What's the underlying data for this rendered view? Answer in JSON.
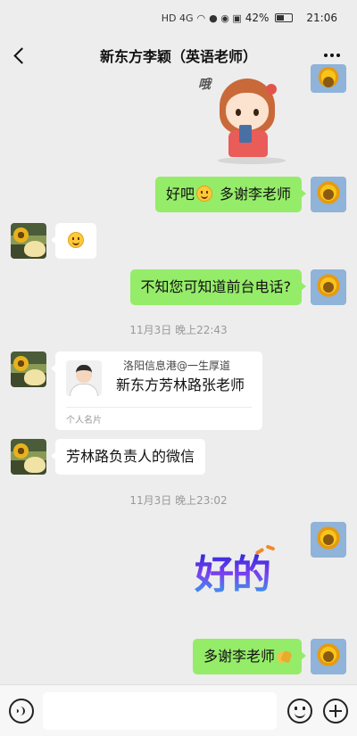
{
  "status_bar": {
    "network": "HD 4G",
    "battery": "42%",
    "time": "21:06"
  },
  "header": {
    "title": "新东方李颖（英语老师）"
  },
  "messages": [
    {
      "from": "me",
      "kind": "sticker",
      "sticker_text": "哦"
    },
    {
      "from": "me",
      "kind": "text",
      "text_before": "好吧",
      "emoji": "smile",
      "text_after": "多谢李老师"
    },
    {
      "from": "them",
      "kind": "emoji",
      "emoji": "smile"
    },
    {
      "from": "me",
      "kind": "text",
      "text": "不知您可知道前台电话?"
    },
    {
      "kind": "timestamp",
      "text": "11月3日 晚上22:43"
    },
    {
      "from": "them",
      "kind": "card",
      "watermark": "洛阳信息港@一生厚道",
      "name": "新东方芳林路张老师",
      "card_type": "个人名片"
    },
    {
      "from": "them",
      "kind": "text",
      "text": "芳林路负责人的微信"
    },
    {
      "kind": "timestamp",
      "text": "11月3日 晚上23:02"
    },
    {
      "from": "me",
      "kind": "sticker",
      "sticker_text": "好的"
    },
    {
      "from": "me",
      "kind": "text",
      "text": "多谢李老师",
      "emoji": "clap"
    }
  ],
  "input_bar": {
    "value": "",
    "icons": [
      "voice-icon",
      "emoji-icon",
      "plus-icon"
    ]
  },
  "colors": {
    "my_bubble": "#95ec69",
    "their_bubble": "#ffffff",
    "background": "#ededed"
  }
}
